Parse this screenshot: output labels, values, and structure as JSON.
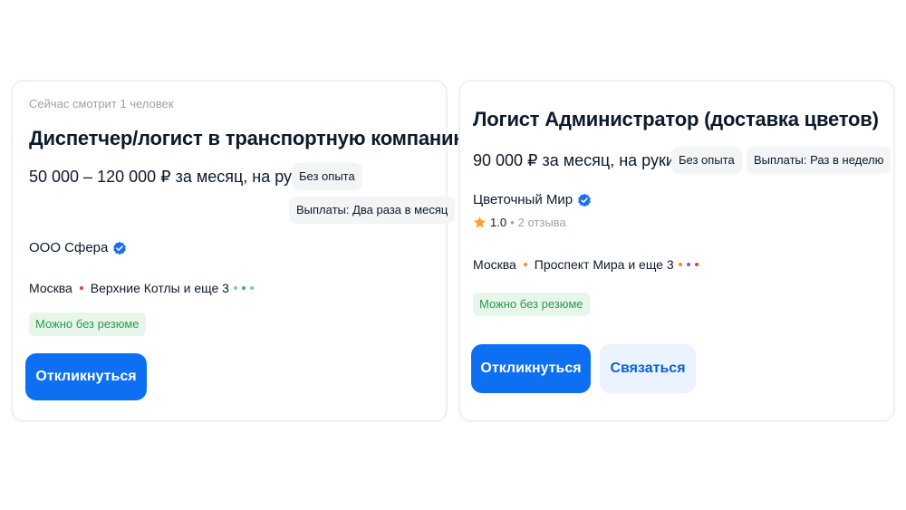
{
  "colors": {
    "accent": "#0d70f2",
    "verified": "#1a6ef5",
    "green_text": "#2c9a48",
    "green_bg": "#e7f6ea",
    "chip_bg": "#f2f4f6",
    "star": "#f5a623"
  },
  "vacancies": [
    {
      "viewing_now": "Сейчас смотрит 1 человек",
      "title": "Диспетчер/логист в транспортную компанию",
      "salary": "50 000 – 120 000 ₽ за месяц, на руки",
      "chips": [
        "Без опыта",
        "Выплаты: Два раза в месяц"
      ],
      "company": "ООО Сфера",
      "company_icon": "verified-check-icon",
      "city": "Москва",
      "metro": "Верхние Котлы и еще 3",
      "metro_dot_color": "#e0413c",
      "extra_dots": [
        "#7fc4d8",
        "#3ab36b",
        "#8ab6f0"
      ],
      "tag": "Можно без резюме",
      "respond_label": "Откликнуться"
    },
    {
      "title": "Логист Администратор (доставка цветов)",
      "salary": "90 000 ₽ за месяц, на руки",
      "chips": [
        "Без опыта",
        "Выплаты: Раз в неделю"
      ],
      "company": "Цветочный Мир",
      "company_icon": "verified-check-icon",
      "rating": "1.0",
      "reviews": "2 отзыва",
      "rating_icon": "star-icon",
      "city": "Москва",
      "metro": "Проспект Мира и еще 3",
      "metro_dot_color": "#f08a2c",
      "extra_dots": [
        "#f08a2c",
        "#6f63c9",
        "#e0413c"
      ],
      "tag": "Можно без резюме",
      "respond_label": "Откликнуться",
      "contact_label": "Связаться"
    }
  ]
}
